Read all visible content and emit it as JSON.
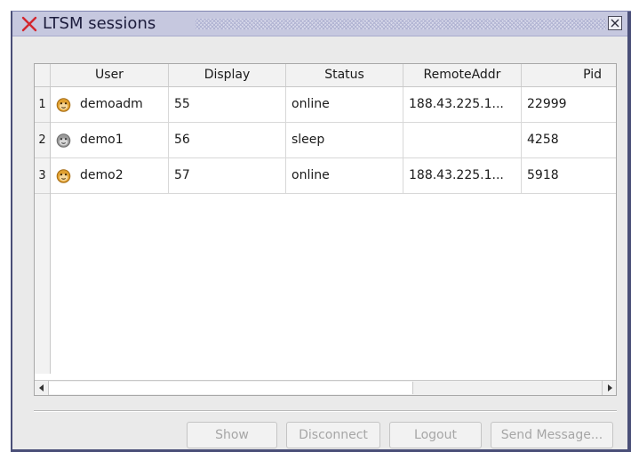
{
  "window": {
    "title": "LTSM sessions",
    "accent": "#d3262e"
  },
  "table": {
    "columns": [
      "User",
      "Display",
      "Status",
      "RemoteAddr",
      "Pid"
    ],
    "rows": [
      {
        "num": "1",
        "user": "demoadm",
        "icon": "monkey-face-icon",
        "display": "55",
        "status": "online",
        "remote": "188.43.225.1...",
        "pid": "22999"
      },
      {
        "num": "2",
        "user": "demo1",
        "icon": "monkey-face-icon",
        "display": "56",
        "status": "sleep",
        "remote": "",
        "pid": "4258"
      },
      {
        "num": "3",
        "user": "demo2",
        "icon": "monkey-face-icon",
        "display": "57",
        "status": "online",
        "remote": "188.43.225.1...",
        "pid": "5918"
      }
    ]
  },
  "buttons": {
    "show": "Show",
    "disconnect": "Disconnect",
    "logout": "Logout",
    "send_message": "Send Message..."
  }
}
